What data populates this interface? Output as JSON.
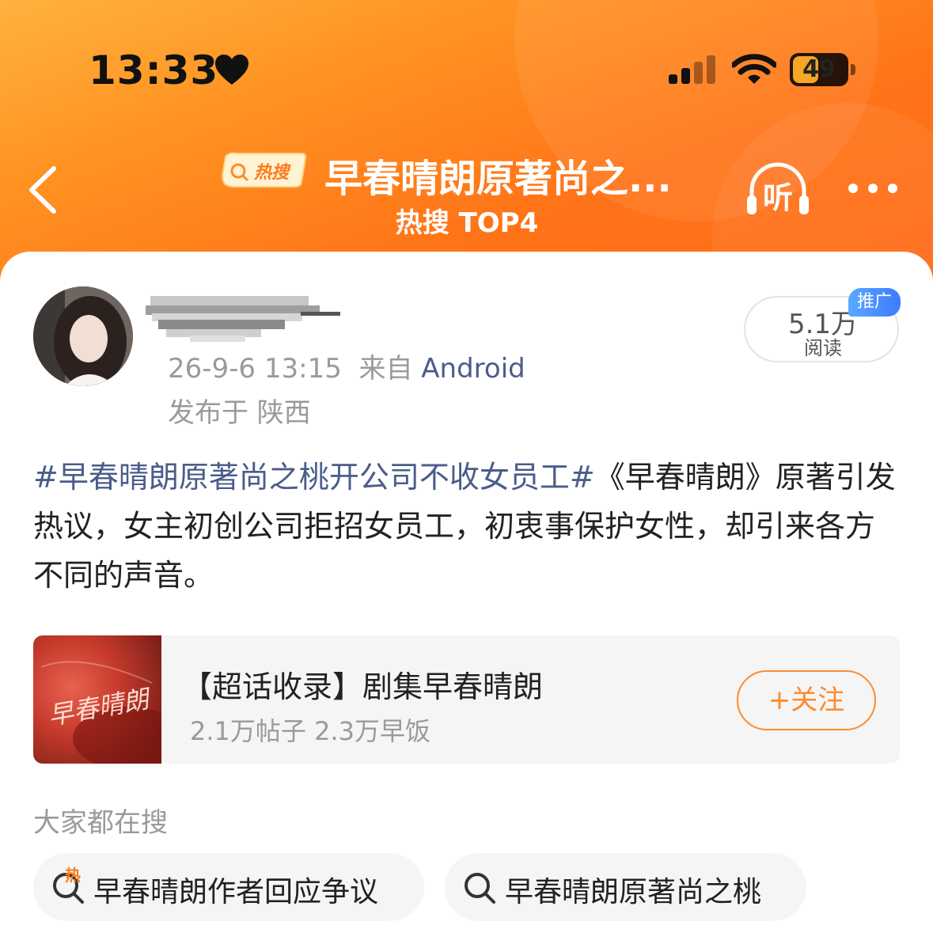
{
  "status_bar": {
    "time": "13:33",
    "battery_level": "49"
  },
  "nav": {
    "hot_badge_label": "热搜",
    "title": "早春晴朗原著尚之...",
    "subtitle": "热搜 TOP4",
    "listen_label": "听"
  },
  "post": {
    "timestamp": "26-9-6 13:15",
    "source_prefix": "来自",
    "source": "Android",
    "location": "发布于 陕西",
    "reads_count": "5.1万",
    "reads_label": "阅读",
    "promo_tag": "推广",
    "hashtag": "#早春晴朗原著尚之桃开公司不收女员工#",
    "body": "《早春晴朗》原著引发热议，女主初创公司拒招女员工，初衷事保护女性，却引来各方不同的声音。"
  },
  "topic_card": {
    "thumb_text": "早春晴朗",
    "title": "【超话收录】剧集早春晴朗",
    "stats": "2.1万帖子 2.3万早饭",
    "follow_label": "+关注"
  },
  "related_searches": {
    "heading": "大家都在搜",
    "items": [
      {
        "label": "早春晴朗作者回应争议",
        "badge": "热"
      },
      {
        "label": "早春晴朗原著尚之桃"
      }
    ]
  },
  "colors": {
    "accent_orange": "#ff8a2a",
    "link_blue": "#4a5d8a",
    "header_gradient_start": "#ffb23e",
    "header_gradient_end": "#ff6a17"
  }
}
